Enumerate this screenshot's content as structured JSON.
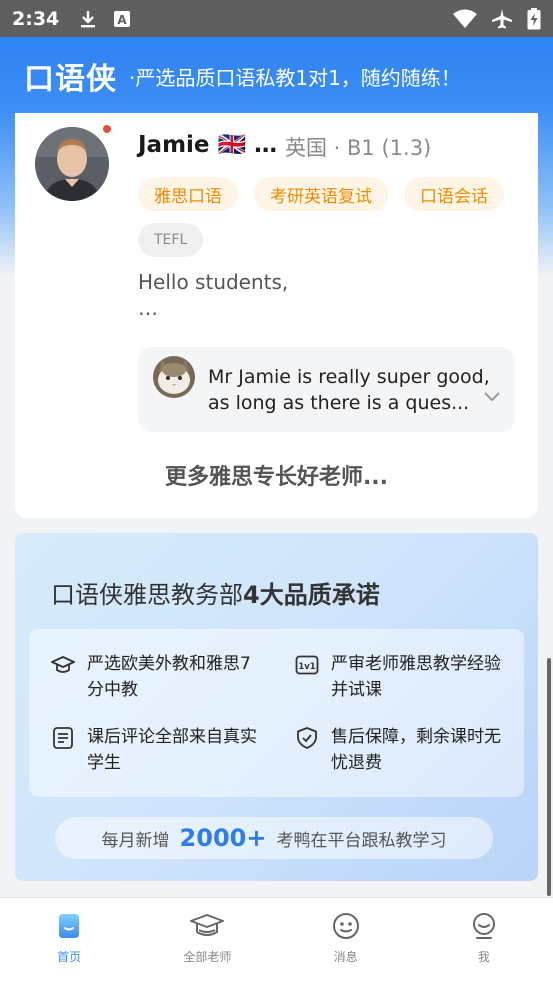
{
  "status_bar": {
    "time": "2:34"
  },
  "header": {
    "brand": "口语侠",
    "slogan": "·严选品质口语私教1对1，随约随练！"
  },
  "teacher": {
    "name": "Jamie 🇬🇧 …",
    "meta": "英国 · B1 (1.3)",
    "tags": [
      "雅思口语",
      "考研英语复试",
      "口语会话",
      "TEFL"
    ],
    "bio_line1": "Hello students,",
    "bio_line2": "…",
    "review_line1": "Mr Jamie is really super good,",
    "review_line2": "as long as there is a ques...",
    "more_label": "更多雅思专长好老师..."
  },
  "promise": {
    "title_prefix": "口语侠雅思教务部",
    "title_bold": "4大品质承诺",
    "items": [
      {
        "icon": "graduation-cap-icon",
        "text": "严选欧美外教和雅思7分中教"
      },
      {
        "icon": "one-on-one-icon",
        "text": "严审老师雅思教学经验并试课"
      },
      {
        "icon": "document-icon",
        "text": "课后评论全部来自真实学生"
      },
      {
        "icon": "shield-check-icon",
        "text": "售后保障，剩余课时无忧退费"
      }
    ],
    "growth_prefix": "每月新增",
    "growth_number": "2000+",
    "growth_suffix": "考鸭在平台跟私教学习"
  },
  "bottom_nav": {
    "items": [
      {
        "label": "首页",
        "icon": "home-icon",
        "active": true
      },
      {
        "label": "全部老师",
        "icon": "teachers-icon",
        "active": false
      },
      {
        "label": "消息",
        "icon": "message-icon",
        "active": false
      },
      {
        "label": "我",
        "icon": "profile-icon",
        "active": false
      }
    ]
  },
  "colors": {
    "accent": "#3a8bf0",
    "tag_text": "#f08c00",
    "tag_bg": "#fff5e6",
    "online_dot": "#e84a3c"
  }
}
